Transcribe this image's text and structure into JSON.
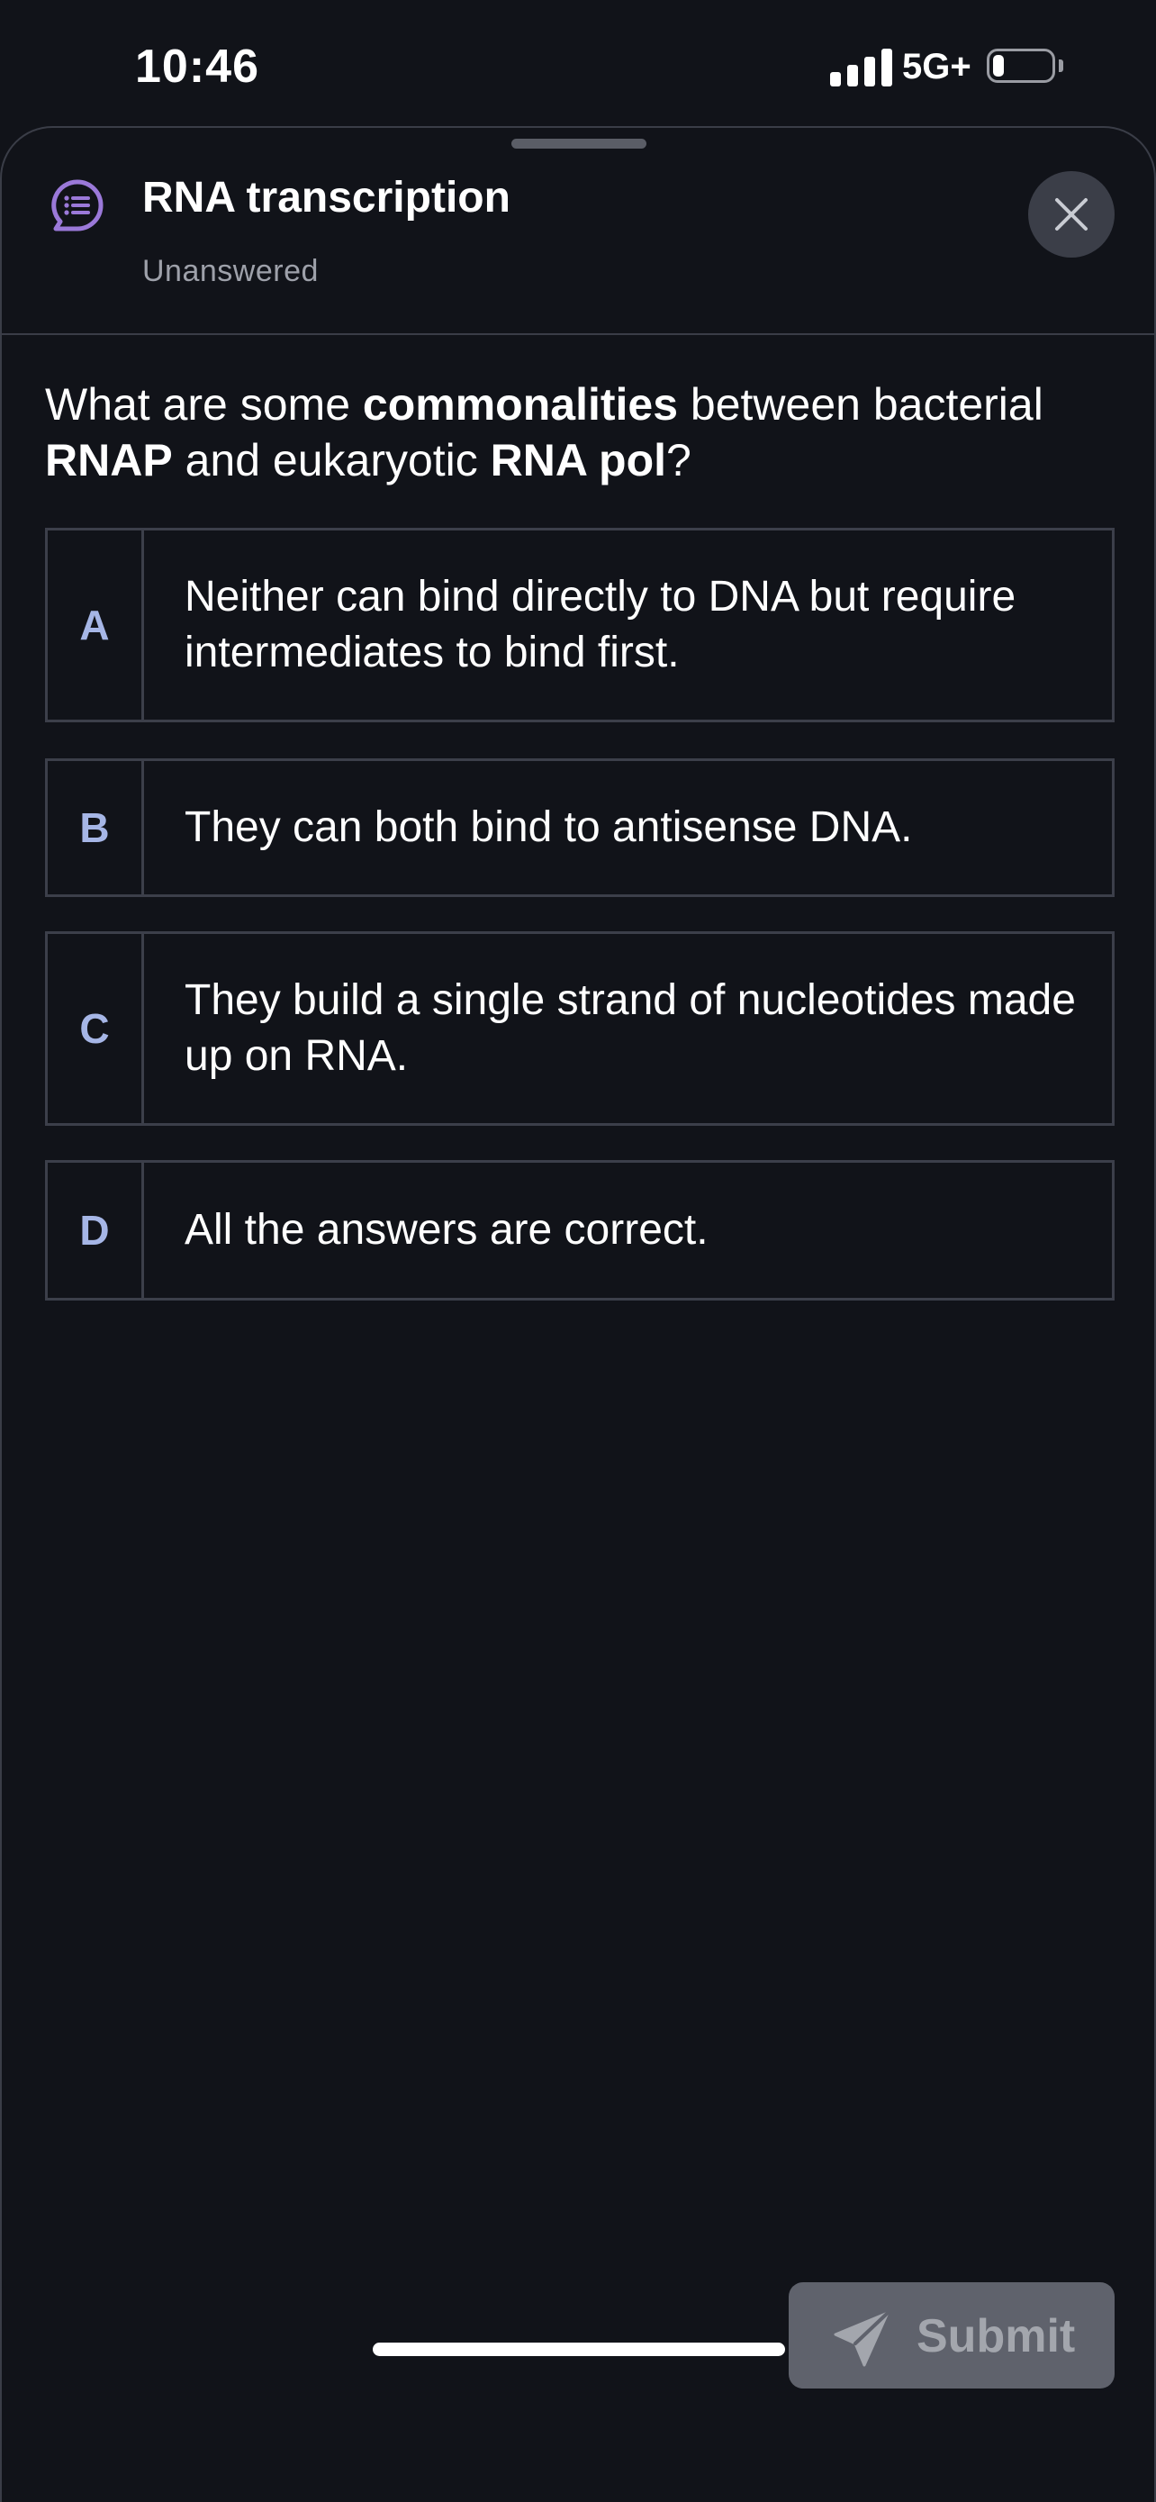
{
  "status_bar": {
    "time": "10:46",
    "network": "5G+",
    "signal_bars": 4,
    "battery_level": 0.2
  },
  "sheet": {
    "title": "RNA transcription",
    "status": "Unanswered",
    "icon": "chat-list-icon",
    "accent_color": "#9b79d9"
  },
  "question": {
    "parts": [
      {
        "text": "What are some ",
        "bold": false
      },
      {
        "text": "commonalities",
        "bold": true
      },
      {
        "text": " between bacterial ",
        "bold": false
      },
      {
        "text": "RNAP",
        "bold": true
      },
      {
        "text": " and eukaryotic ",
        "bold": false
      },
      {
        "text": "RNA pol",
        "bold": true
      },
      {
        "text": "?",
        "bold": false
      }
    ]
  },
  "options": [
    {
      "letter": "A",
      "text": "Neither can bind directly to DNA but require intermediates to bind first."
    },
    {
      "letter": "B",
      "text": "They can both bind to antisense DNA."
    },
    {
      "letter": "C",
      "text": "They build a single strand of nucleotides made up on RNA."
    },
    {
      "letter": "D",
      "text": "All the answers are correct."
    }
  ],
  "submit": {
    "label": "Submit",
    "icon": "send-icon",
    "enabled": false
  }
}
